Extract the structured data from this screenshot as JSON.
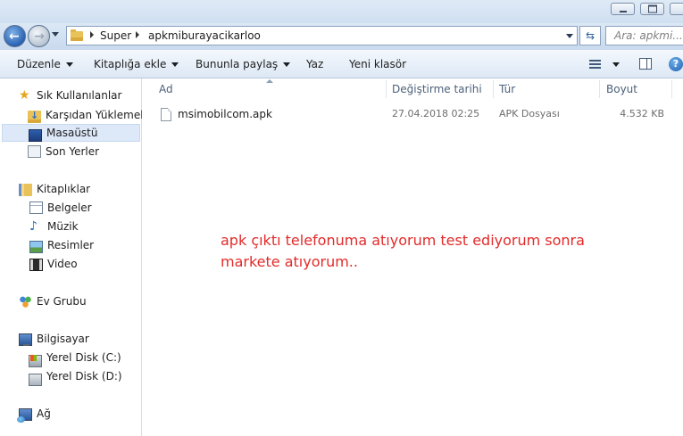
{
  "window": {
    "controls": {
      "minimize_icon": "minimize-icon",
      "maximize_icon": "maximize-icon",
      "close_icon": "close-icon"
    }
  },
  "address_bar": {
    "breadcrumbs": [
      "Super",
      "apkmiburayacikarloo"
    ],
    "search_placeholder": "Ara: apkmi..."
  },
  "toolbar": {
    "organize_label": "Düzenle",
    "include_library_label": "Kitaplığa ekle",
    "share_label": "Bununla paylaş",
    "burn_label": "Yaz",
    "new_folder_label": "Yeni klasör"
  },
  "sidebar": {
    "favorites": {
      "label": "Sık Kullanılanlar",
      "items": [
        {
          "label": "Karşıdan Yüklemeler",
          "icon": "downloads-icon"
        },
        {
          "label": "Masaüstü",
          "icon": "desktop-icon",
          "selected": true
        },
        {
          "label": "Son Yerler",
          "icon": "recent-places-icon"
        }
      ]
    },
    "libraries": {
      "label": "Kitaplıklar",
      "items": [
        {
          "label": "Belgeler",
          "icon": "documents-icon"
        },
        {
          "label": "Müzik",
          "icon": "music-icon"
        },
        {
          "label": "Resimler",
          "icon": "pictures-icon"
        },
        {
          "label": "Video",
          "icon": "video-icon"
        }
      ]
    },
    "homegroup": {
      "label": "Ev Grubu"
    },
    "computer": {
      "label": "Bilgisayar",
      "items": [
        {
          "label": "Yerel Disk (C:)",
          "icon": "local-disk-c-icon"
        },
        {
          "label": "Yerel Disk (D:)",
          "icon": "local-disk-d-icon"
        }
      ]
    },
    "network": {
      "label": "Ağ"
    }
  },
  "file_list": {
    "columns": [
      "Ad",
      "Değiştirme tarihi",
      "Tür",
      "Boyut"
    ],
    "rows": [
      {
        "name": "msimobilcom.apk",
        "modified": "27.04.2018 02:25",
        "type": "APK Dosyası",
        "size": "4.532 KB"
      }
    ]
  },
  "annotation": {
    "lines": [
      "apk çıktı telefonuma atıyorum test ediyorum sonra",
      "markete atıyorum.."
    ],
    "color": "#e32a2a"
  },
  "colors": {
    "selection": "#dde8f8",
    "header_text": "#4c607a",
    "toolbar_bg": "#dde8f5"
  }
}
